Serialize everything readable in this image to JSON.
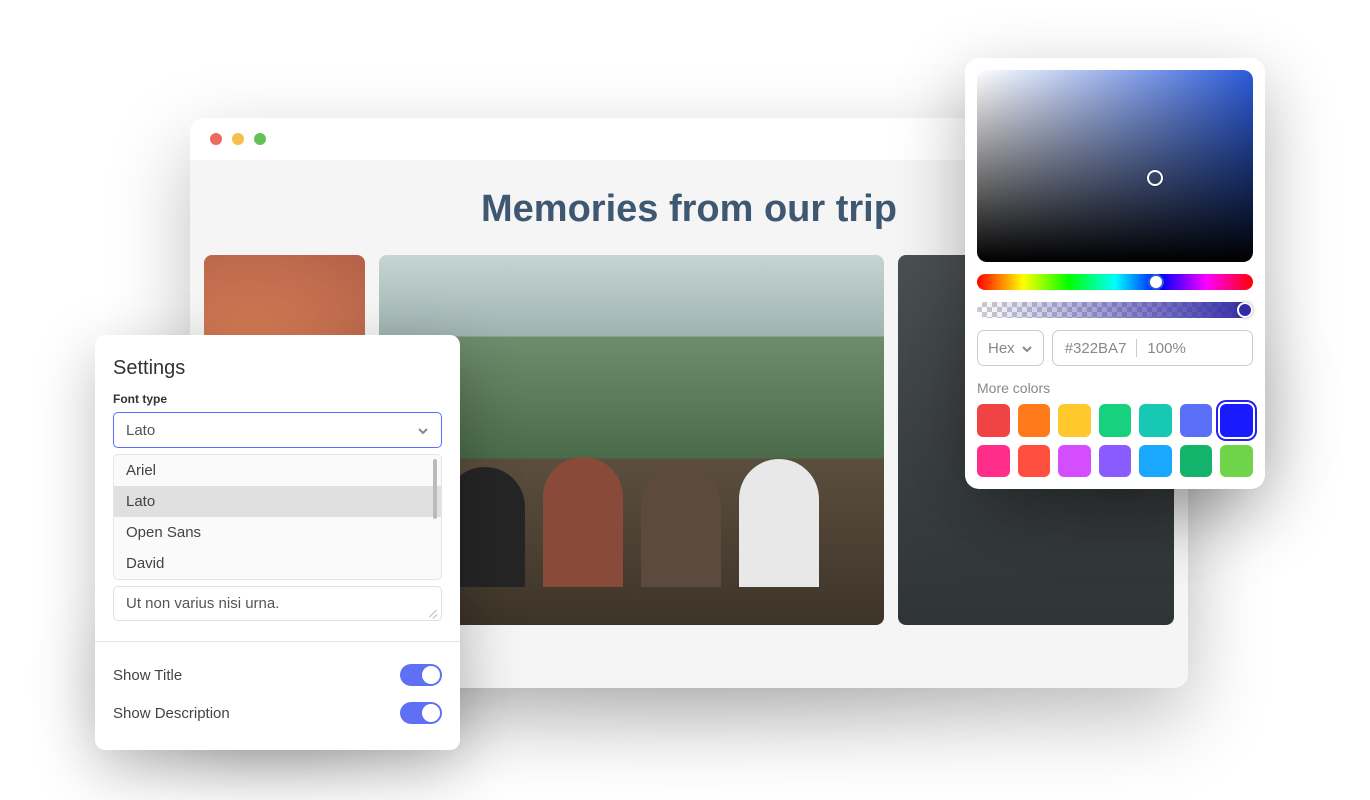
{
  "page": {
    "title": "Memories from our trip"
  },
  "settings": {
    "heading": "Settings",
    "font_type_label": "Font type",
    "font_selected": "Lato",
    "font_options": [
      "Ariel",
      "Lato",
      "Open Sans",
      "David"
    ],
    "description_value": "Ut non varius nisi urna.",
    "show_title_label": "Show Title",
    "show_title_on": true,
    "show_description_label": "Show Description",
    "show_description_on": true
  },
  "picker": {
    "format_label": "Hex",
    "hex_value": "#322BA7",
    "alpha_value": "100%",
    "more_colors_label": "More colors",
    "swatches_row1": [
      "#f04444",
      "#ff7a1a",
      "#ffc82c",
      "#17d17e",
      "#17c9b2",
      "#5a6ff5",
      "#1a1aff"
    ],
    "swatches_row2": [
      "#ff2e8a",
      "#ff4f3f",
      "#d44dff",
      "#8a5cff",
      "#1aa8ff",
      "#14b36b",
      "#6fd44a"
    ],
    "selected_swatch_index": 6
  }
}
